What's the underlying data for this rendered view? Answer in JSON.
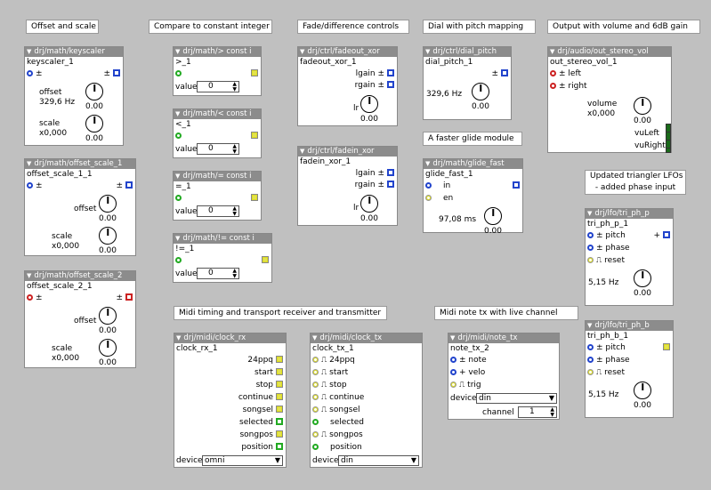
{
  "comments": {
    "offset_scale": "Offset and scale",
    "compare": "Compare to constant integer",
    "fade": "Fade/difference controls",
    "dial": "Dial with pitch mapping",
    "output": "Output with volume  and 6dB gain",
    "glide": "A faster glide module",
    "tri1": "Updated triangler LFOs",
    "tri2": "- added phase input",
    "midi_timing": "Midi timing and transport receiver and transmitter",
    "midi_note": "Midi note tx with live channel"
  },
  "objects": {
    "keyscaler": {
      "type": "drj/math/keyscaler",
      "name": "keyscaler_1",
      "in": "±",
      "out": "±",
      "offset_label": "offset",
      "offset_value": "329,6 Hz",
      "offset_knob": "0.00",
      "scale_label": "scale",
      "scale_value": "x0,000",
      "scale_knob": "0.00"
    },
    "offset_scale_1": {
      "type": "drj/math/offset_scale_1",
      "name": "offset_scale_1_1",
      "in": "±",
      "out": "±",
      "offset_label": "offset",
      "offset_knob": "0.00",
      "scale_label": "scale",
      "scale_value": "x0,000",
      "scale_knob": "0.00"
    },
    "offset_scale_2": {
      "type": "drj/math/offset_scale_2",
      "name": "offset_scale_2_1",
      "in": "±",
      "out": "±",
      "offset_label": "offset",
      "offset_knob": "0.00",
      "scale_label": "scale",
      "scale_value": "x0,000",
      "scale_knob": "0.00"
    },
    "gt": {
      "type": "drj/math/> const i",
      "name": ">_1",
      "value_label": "value",
      "value": "0"
    },
    "lt": {
      "type": "drj/math/< const i",
      "name": "<_1",
      "value_label": "value",
      "value": "0"
    },
    "eq": {
      "type": "drj/math/= const i",
      "name": "=_1",
      "value_label": "value",
      "value": "0"
    },
    "neq": {
      "type": "drj/math/!= const i",
      "name": "!=_1",
      "value_label": "value",
      "value": "0"
    },
    "fadeout": {
      "type": "drj/ctrl/fadeout_xor",
      "name": "fadeout_xor_1",
      "lgain": "lgain ±",
      "rgain": "rgain ±",
      "lr": "lr",
      "knob": "0.00"
    },
    "fadein": {
      "type": "drj/ctrl/fadein_xor",
      "name": "fadein_xor_1",
      "lgain": "lgain ±",
      "rgain": "rgain ±",
      "lr": "lr",
      "knob": "0.00"
    },
    "dial_pitch": {
      "type": "drj/ctrl/dial_pitch",
      "name": "dial_pitch_1",
      "out": "±",
      "value": "329,6 Hz",
      "knob": "0.00"
    },
    "out_stereo": {
      "type": "drj/audio/out_stereo_vol",
      "name": "out_stereo_vol_1",
      "left": "± left",
      "right": "± right",
      "volume_label": "volume",
      "volume_value": "x0,000",
      "knob": "0.00",
      "vu_left": "vuLeft",
      "vu_right": "vuRight"
    },
    "glide_fast": {
      "type": "drj/math/glide_fast",
      "name": "glide_fast_1",
      "in": "in",
      "en": "en",
      "value": "97,08 ms",
      "knob": "0.00"
    },
    "tri_p": {
      "type": "drj/lfo/tri_ph_p",
      "name": "tri_ph_p_1",
      "pitch": "± pitch",
      "phase": "± phase",
      "reset": "reset",
      "out": "+",
      "value": "5,15 Hz",
      "knob": "0.00"
    },
    "tri_b": {
      "type": "drj/lfo/tri_ph_b",
      "name": "tri_ph_b_1",
      "pitch": "± pitch",
      "phase": "± phase",
      "reset": "reset",
      "value": "5,15 Hz",
      "knob": "0.00"
    },
    "clock_rx": {
      "type": "drj/midi/clock_rx",
      "name": "clock_rx_1",
      "outputs": [
        "24ppq",
        "start",
        "stop",
        "continue",
        "songsel",
        "selected",
        "songpos",
        "position"
      ],
      "device_label": "device",
      "device": "omni"
    },
    "clock_tx": {
      "type": "drj/midi/clock_tx",
      "name": "clock_tx_1",
      "inputs": [
        "24ppq",
        "start",
        "stop",
        "continue",
        "songsel",
        "selected",
        "songpos",
        "position"
      ],
      "device_label": "device",
      "device": "din"
    },
    "note_tx": {
      "type": "drj/midi/note_tx",
      "name": "note_tx_2",
      "note": "± note",
      "velo": "+ velo",
      "trig": "trig",
      "device_label": "device",
      "device": "din",
      "channel_label": "channel",
      "channel": "1"
    }
  },
  "colors": {
    "background": "#c0c0c0",
    "header": "#8c8c8c",
    "inlet_blue": "#2244cc",
    "inlet_red": "#cc2222",
    "inlet_green": "#22aa22",
    "inlet_yellow": "#dddd22"
  }
}
